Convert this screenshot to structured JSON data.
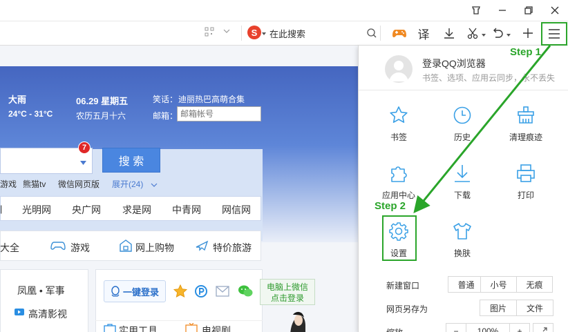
{
  "toolbar": {
    "search_placeholder": "在此搜索"
  },
  "weather": {
    "condition": "大雨",
    "temp": "24°C - 31°C",
    "date": "06.29 星期五",
    "lunar": "农历五月十六"
  },
  "joke": {
    "label": "笑话：",
    "text": "迪丽热巴高萌合集"
  },
  "mail": {
    "label": "邮箱：",
    "placeholder": "邮箱帐号"
  },
  "search": {
    "badge": "7",
    "button": "搜 索",
    "links": [
      "游戏",
      "熊猫tv",
      "微信网页版"
    ],
    "expand": "展开(24)"
  },
  "sites": [
    "光明网",
    "央广网",
    "求是网",
    "中青网",
    "网信网"
  ],
  "categories": [
    "大全",
    "游戏",
    "网上购物",
    "特价旅游"
  ],
  "left_list": [
    "凤凰 • 军事",
    "高清影视"
  ],
  "login": {
    "button": "一键登录",
    "wechat_tip_line1": "电脑上微信",
    "wechat_tip_line2": "点击登录"
  },
  "bottom": [
    "实用工具",
    "电视剧"
  ],
  "menu": {
    "account_title": "登录QQ浏览器",
    "account_sub": "书签、选项、应用云同步，永不丢失",
    "items": [
      {
        "label": "书签",
        "icon": "star-icon"
      },
      {
        "label": "历史",
        "icon": "clock-icon"
      },
      {
        "label": "清理痕迹",
        "icon": "broom-icon"
      },
      {
        "label": "应用中心",
        "icon": "puzzle-icon"
      },
      {
        "label": "下载",
        "icon": "download-icon"
      },
      {
        "label": "打印",
        "icon": "printer-icon"
      },
      {
        "label": "设置",
        "icon": "gear-icon"
      },
      {
        "label": "换肤",
        "icon": "tshirt-icon"
      }
    ],
    "new_window": {
      "label": "新建窗口",
      "options": [
        "普通",
        "小号",
        "无痕"
      ]
    },
    "save_as": {
      "label": "网页另存为",
      "options": [
        "图片",
        "文件"
      ]
    },
    "zoom": {
      "label": "缩放",
      "minus": "−",
      "value": "100%",
      "plus": "+"
    }
  },
  "annotations": {
    "step1": "Step 1",
    "step2": "Step 2",
    "color": "#2aa52a"
  }
}
